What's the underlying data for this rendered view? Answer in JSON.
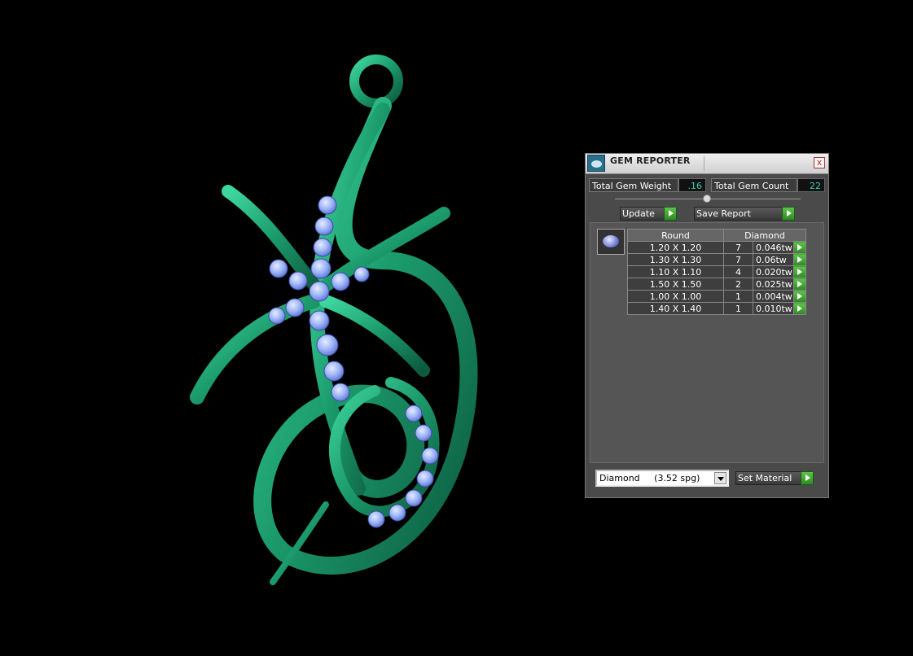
{
  "panel": {
    "title": "GEM REPORTER",
    "close_label": "x",
    "total_weight_label": "Total Gem Weight",
    "total_weight_value": ".16",
    "total_count_label": "Total Gem Count",
    "total_count_value": "22",
    "update_label": "Update",
    "save_label": "Save Report",
    "table": {
      "headers": [
        "Round",
        "Diamond"
      ],
      "rows": [
        {
          "size": "1.20 X 1.20",
          "count": "7",
          "weight": "0.046tw"
        },
        {
          "size": "1.30 X 1.30",
          "count": "7",
          "weight": "0.06tw"
        },
        {
          "size": "1.10 X 1.10",
          "count": "4",
          "weight": "0.020tw"
        },
        {
          "size": "1.50 X 1.50",
          "count": "2",
          "weight": "0.025tw"
        },
        {
          "size": "1.00 X 1.00",
          "count": "1",
          "weight": "0.004tw"
        },
        {
          "size": "1.40 X 1.40",
          "count": "1",
          "weight": "0.010tw"
        }
      ]
    },
    "material_select": "Diamond     (3.52 spg)",
    "set_material_label": "Set Material"
  },
  "colors": {
    "model_green": "#1a9a6c",
    "gem_blue": "#8fa8f5",
    "value_text": "#37d3b8",
    "action_green": "#3aa82e"
  }
}
